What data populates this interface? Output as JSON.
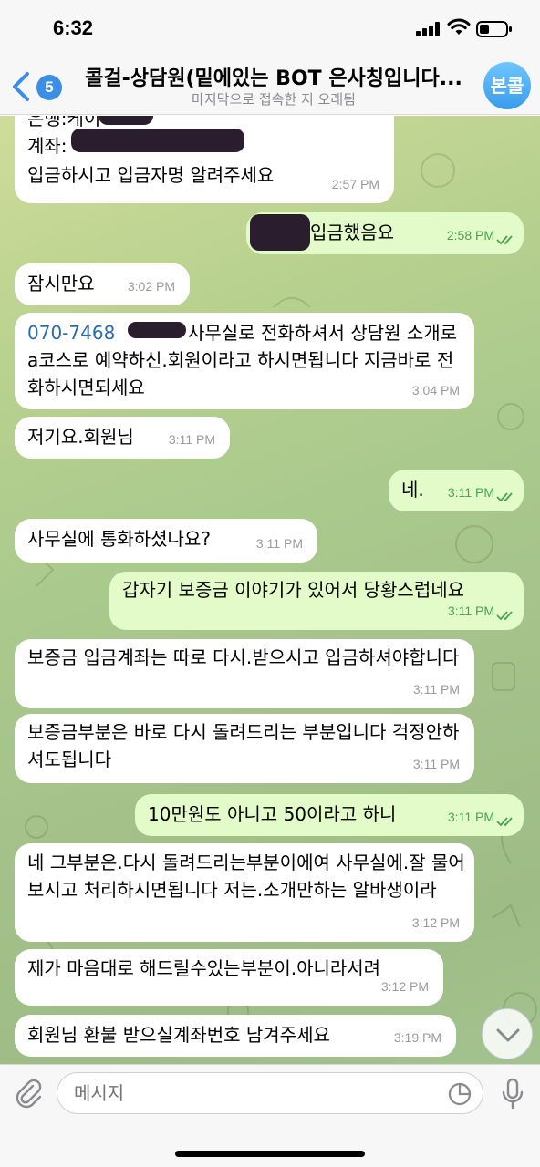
{
  "status": {
    "time": "6:32"
  },
  "header": {
    "back_badge": "5",
    "title": "콜걸-상담원(밑에있는 BOT 은사칭입니다...",
    "subtitle": "마지막으로 접속한 지 오래됨",
    "avatar_text": "본콜"
  },
  "messages": [
    {
      "dir": "in",
      "lines": [
        "은행:케이",
        "계좌:"
      ],
      "time": ""
    },
    {
      "dir": "in",
      "text": "입금하시고 입금자명 알려주세요",
      "time": "2:57 PM"
    },
    {
      "dir": "out",
      "text": "입금했음요",
      "time": "2:58 PM"
    },
    {
      "dir": "in",
      "text": "잠시만요",
      "time": "3:02 PM"
    },
    {
      "dir": "in",
      "phone": "070-7468",
      "text": "사무실로 전화하셔서 상담원 소개로a코스로 예약하신.회원이라고 하시면됩니다 지금바로 전화하시면되세요",
      "time": "3:04 PM"
    },
    {
      "dir": "in",
      "text": "저기요.회원님",
      "time": "3:11 PM"
    },
    {
      "dir": "out",
      "text": "네.",
      "time": "3:11 PM"
    },
    {
      "dir": "in",
      "text": "사무실에 통화하셨나요?",
      "time": "3:11 PM"
    },
    {
      "dir": "out",
      "text": "갑자기 보증금 이야기가 있어서 당황스럽네요",
      "time": "3:11 PM"
    },
    {
      "dir": "in",
      "text": "보증금 입금계좌는 따로 다시.받으시고 입금하셔야합니다",
      "time": "3:11 PM"
    },
    {
      "dir": "in",
      "text": "보증금부분은 바로 다시 돌려드리는 부분입니다 걱정안하셔도됩니다",
      "time": "3:11 PM"
    },
    {
      "dir": "out",
      "text": "10만원도 아니고 50이라고 하니",
      "time": "3:11 PM"
    },
    {
      "dir": "in",
      "text": "네 그부분은.다시 돌려드리는부분이에여 사무실에.잘 물어보시고 처리하시면됩니다 저는.소개만하는 알바생이라",
      "time": "3:12 PM"
    },
    {
      "dir": "in",
      "text": "제가 마음대로 해드릴수있는부분이.아니라서려",
      "time": "3:12 PM"
    },
    {
      "dir": "in",
      "text": "회원님 환불 받으실계좌번호 남겨주세요",
      "time": "3:19 PM"
    }
  ],
  "composer": {
    "placeholder": "메시지"
  },
  "colors": {
    "accent": "#3a8ee6",
    "out_bubble": "#e2fbc9",
    "in_bubble": "#ffffff",
    "out_time": "#4ca153"
  },
  "icons": {
    "back": "chevron-left-icon",
    "attach": "paperclip-icon",
    "sticker": "sticker-icon",
    "mic": "microphone-icon",
    "scroll": "chevron-down-icon"
  }
}
